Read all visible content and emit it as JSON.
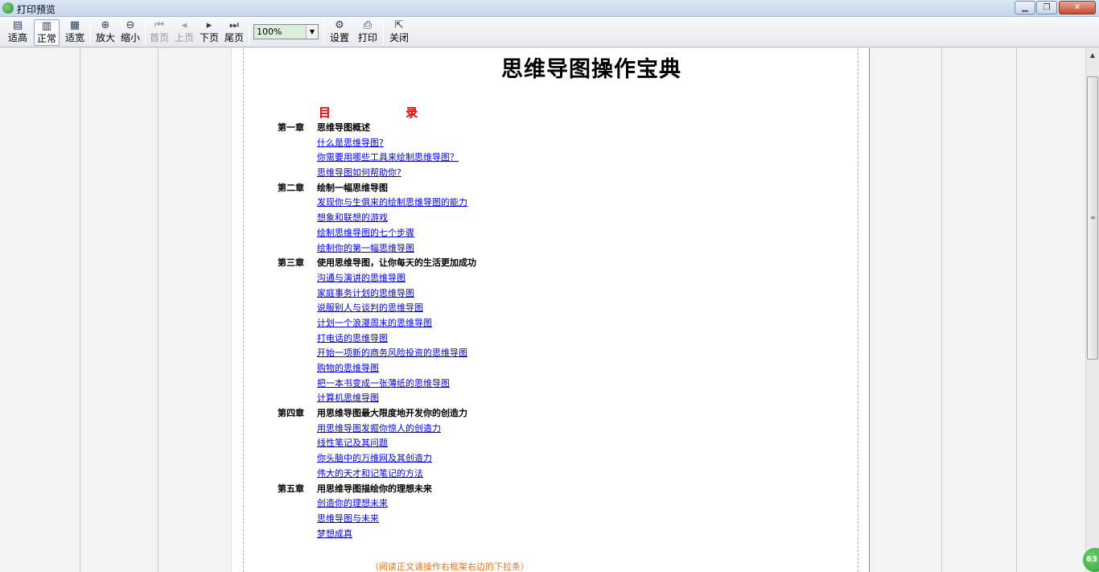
{
  "window": {
    "title": "打印预览"
  },
  "toolbar": {
    "buttons": [
      {
        "label": "适高",
        "icon": "fit-height-icon"
      },
      {
        "label": "正常",
        "icon": "normal-view-icon"
      },
      {
        "label": "适宽",
        "icon": "fit-width-icon"
      },
      {
        "label": "放大",
        "icon": "zoom-in-icon"
      },
      {
        "label": "缩小",
        "icon": "zoom-out-icon"
      },
      {
        "label": "首页",
        "icon": "first-page-icon"
      },
      {
        "label": "上页",
        "icon": "prev-page-icon"
      },
      {
        "label": "下页",
        "icon": "next-page-icon"
      },
      {
        "label": "尾页",
        "icon": "last-page-icon"
      },
      {
        "label": "设置",
        "icon": "settings-icon"
      },
      {
        "label": "打印",
        "icon": "printer-icon"
      },
      {
        "label": "关闭",
        "icon": "close-icon"
      }
    ],
    "zoom": "100%"
  },
  "document": {
    "title": "思维导图操作宝典",
    "toc_heading": "目 录",
    "chapters": [
      {
        "num": "第一章",
        "title": "思维导图概述",
        "items": [
          "什么是思维导图?",
          "你需要用哪些工具来绘制思维导图？",
          "思维导图如何帮助你?"
        ]
      },
      {
        "num": "第二章",
        "title": "绘制一幅思维导图",
        "items": [
          "发现你与生俱来的绘制思维导图的能力",
          "想象和联想的游戏",
          "绘制思维导图的七个步骤",
          "绘制你的第一幅思维导图"
        ]
      },
      {
        "num": "第三章",
        "title": "使用思维导图，让你每天的生活更加成功",
        "items": [
          "沟通与演讲的思维导图",
          "家庭事务计划的思维导图",
          "说服别人与谈判的思维导图",
          "计划一个浪漫周末的思维导图",
          "打电话的思维导图",
          "开始一项新的商务风险投资的思维导图",
          "购物的思维导图",
          "把一本书变成一张薄纸的思维导图",
          "计算机思维导图"
        ]
      },
      {
        "num": "第四章",
        "title": "用思维导图最大限度地开发你的创造力",
        "items": [
          "用思维导图发掘你惊人的创造力",
          "线性笔记及其问题",
          "你头脑中的万维网及其创造力",
          "伟大的天才和记笔记的方法"
        ]
      },
      {
        "num": "第五章",
        "title": "用思维导图描绘你的理想未来",
        "items": [
          "创造你的理想未来",
          "思维导图与未来",
          "梦想成真"
        ]
      }
    ],
    "footer_note": "（阅读正文请操作右框架右边的下拉条）"
  },
  "badge": "63"
}
